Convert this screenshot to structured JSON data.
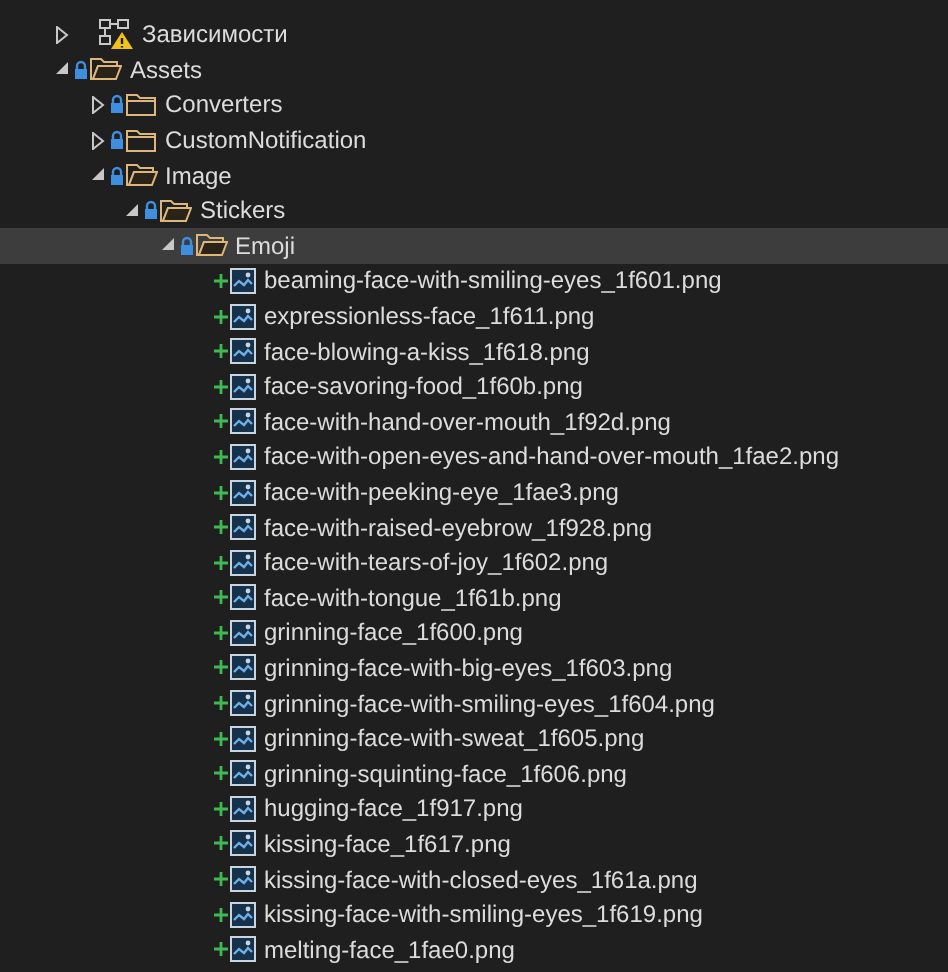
{
  "tree": [
    {
      "kind": "dependencies",
      "label": "Зависимости",
      "warning": true,
      "expanded": false,
      "selected": false
    },
    {
      "kind": "folder",
      "label": "Assets",
      "locked": true,
      "expanded": true,
      "selected": false,
      "children": [
        {
          "kind": "folder",
          "label": "Converters",
          "locked": true,
          "expanded": false,
          "selected": false
        },
        {
          "kind": "folder",
          "label": "CustomNotification",
          "locked": true,
          "expanded": false,
          "selected": false
        },
        {
          "kind": "folder",
          "label": "Image",
          "locked": true,
          "expanded": true,
          "selected": false,
          "children": [
            {
              "kind": "folder",
              "label": "Stickers",
              "locked": true,
              "expanded": true,
              "selected": false,
              "children": [
                {
                  "kind": "folder",
                  "label": "Emoji",
                  "locked": true,
                  "expanded": true,
                  "selected": true,
                  "children": [
                    {
                      "kind": "file",
                      "label": "beaming-face-with-smiling-eyes_1f601.png",
                      "added": true,
                      "selected": false
                    },
                    {
                      "kind": "file",
                      "label": "expressionless-face_1f611.png",
                      "added": true,
                      "selected": false
                    },
                    {
                      "kind": "file",
                      "label": "face-blowing-a-kiss_1f618.png",
                      "added": true,
                      "selected": false
                    },
                    {
                      "kind": "file",
                      "label": "face-savoring-food_1f60b.png",
                      "added": true,
                      "selected": false
                    },
                    {
                      "kind": "file",
                      "label": "face-with-hand-over-mouth_1f92d.png",
                      "added": true,
                      "selected": false
                    },
                    {
                      "kind": "file",
                      "label": "face-with-open-eyes-and-hand-over-mouth_1fae2.png",
                      "added": true,
                      "selected": false
                    },
                    {
                      "kind": "file",
                      "label": "face-with-peeking-eye_1fae3.png",
                      "added": true,
                      "selected": false
                    },
                    {
                      "kind": "file",
                      "label": "face-with-raised-eyebrow_1f928.png",
                      "added": true,
                      "selected": false
                    },
                    {
                      "kind": "file",
                      "label": "face-with-tears-of-joy_1f602.png",
                      "added": true,
                      "selected": false
                    },
                    {
                      "kind": "file",
                      "label": "face-with-tongue_1f61b.png",
                      "added": true,
                      "selected": false
                    },
                    {
                      "kind": "file",
                      "label": "grinning-face_1f600.png",
                      "added": true,
                      "selected": false
                    },
                    {
                      "kind": "file",
                      "label": "grinning-face-with-big-eyes_1f603.png",
                      "added": true,
                      "selected": false
                    },
                    {
                      "kind": "file",
                      "label": "grinning-face-with-smiling-eyes_1f604.png",
                      "added": true,
                      "selected": false
                    },
                    {
                      "kind": "file",
                      "label": "grinning-face-with-sweat_1f605.png",
                      "added": true,
                      "selected": false
                    },
                    {
                      "kind": "file",
                      "label": "grinning-squinting-face_1f606.png",
                      "added": true,
                      "selected": false
                    },
                    {
                      "kind": "file",
                      "label": "hugging-face_1f917.png",
                      "added": true,
                      "selected": false
                    },
                    {
                      "kind": "file",
                      "label": "kissing-face_1f617.png",
                      "added": true,
                      "selected": false
                    },
                    {
                      "kind": "file",
                      "label": "kissing-face-with-closed-eyes_1f61a.png",
                      "added": true,
                      "selected": false
                    },
                    {
                      "kind": "file",
                      "label": "kissing-face-with-smiling-eyes_1f619.png",
                      "added": true,
                      "selected": false
                    },
                    {
                      "kind": "file",
                      "label": "melting-face_1fae0.png",
                      "added": true,
                      "selected": false
                    }
                  ]
                }
              ]
            }
          ]
        }
      ]
    }
  ]
}
